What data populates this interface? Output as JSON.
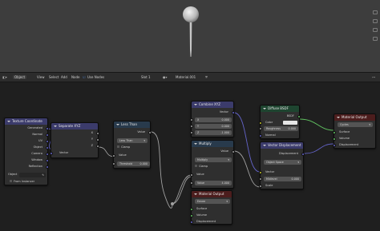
{
  "header": {
    "object_menu": "Object",
    "view": "View",
    "select": "Select",
    "add": "Add",
    "node": "Node",
    "use_nodes": "Use Nodes",
    "slot": "Slot 1",
    "material": "Material.001"
  },
  "nodes": {
    "texcoord": {
      "title": "Texture Coordinate",
      "outputs": [
        "Generated",
        "Normal",
        "UV",
        "Object",
        "Camera",
        "Window",
        "Reflection"
      ],
      "object_label": "Object",
      "from_instancer": "From Instancer"
    },
    "separate": {
      "title": "Separate XYZ",
      "outputs": [
        "X",
        "Y",
        "Z"
      ],
      "input": "Vector"
    },
    "lessthan": {
      "title": "Less Than",
      "output": "Value",
      "operation": "Less Than",
      "clamp": "Clamp",
      "input_value": "Value",
      "threshold_label": "Threshold",
      "threshold_value": "0.000"
    },
    "combine": {
      "title": "Combine XYZ",
      "output": "Vector",
      "x_label": "X",
      "x_value": "0.000",
      "y_label": "Y",
      "y_value": "0.000",
      "z_label": "Z",
      "z_value": "-1.000"
    },
    "multiply": {
      "title": "Multiply",
      "output": "Value",
      "operation": "Multiply",
      "clamp": "Clamp",
      "input_value": "Value",
      "value_label": "Value",
      "value_value": "4.000"
    },
    "diffuse": {
      "title": "Diffuse BSDF",
      "output": "BSDF",
      "color": "Color",
      "roughness_label": "Roughness",
      "roughness_value": "0.000",
      "normal": "Normal"
    },
    "vdisp": {
      "title": "Vector Displacement",
      "output": "Displacement",
      "space": "Object Space",
      "vector": "Vector",
      "midlevel_label": "Midlevel",
      "midlevel_value": "0.000",
      "scale": "Scale"
    },
    "matout1": {
      "title": "Material Output",
      "target": "Cycles",
      "surface": "Surface",
      "volume": "Volume",
      "displacement": "Displacement"
    },
    "matout2": {
      "title": "Material Output",
      "target": "Eevee",
      "surface": "Surface",
      "volume": "Volume",
      "displacement": "Displacement"
    }
  },
  "colors": {
    "vector_socket": "#6363c7",
    "color_socket": "#c7c729",
    "value_socket": "#a1a1a1",
    "shader_socket": "#63c763",
    "viewport_bg": "#3d3d3d",
    "editor_bg": "#1f1f1f"
  }
}
